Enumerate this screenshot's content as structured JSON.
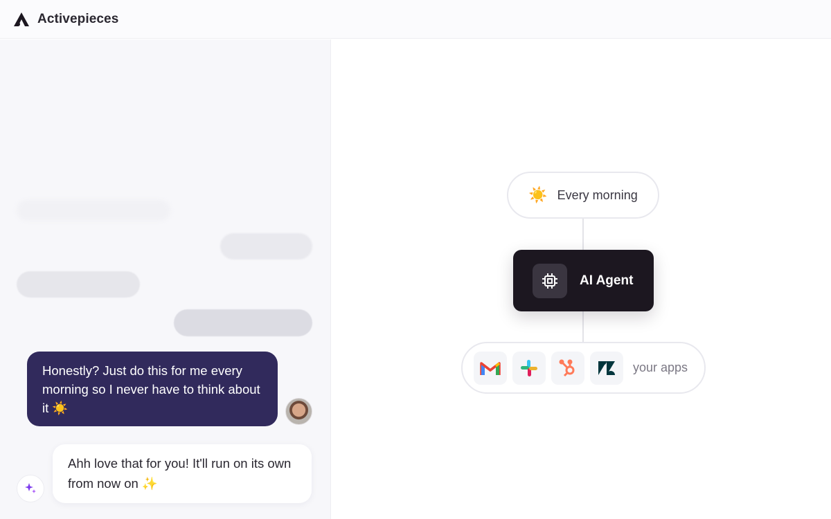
{
  "header": {
    "brand": "Activepieces",
    "logo_icon": "activepieces-logo-icon"
  },
  "chat": {
    "user_message": "Honestly? Just do this for me every morning so I never have to think about it ☀️",
    "bot_message": "Ahh love that for you! It'll run on its own from now on ✨",
    "user_avatar_icon": "user-avatar",
    "bot_icon": "sparkle-icon",
    "colors": {
      "user_bubble": "#312a5c",
      "bot_icon": "#7c3aed"
    }
  },
  "flow": {
    "trigger": {
      "icon": "☀️",
      "label": "Every morning"
    },
    "agent": {
      "icon": "chip-icon",
      "label": "AI Agent"
    },
    "apps": {
      "items": [
        "gmail-icon",
        "slack-icon",
        "hubspot-icon",
        "zendesk-icon"
      ],
      "label": "your apps"
    }
  }
}
